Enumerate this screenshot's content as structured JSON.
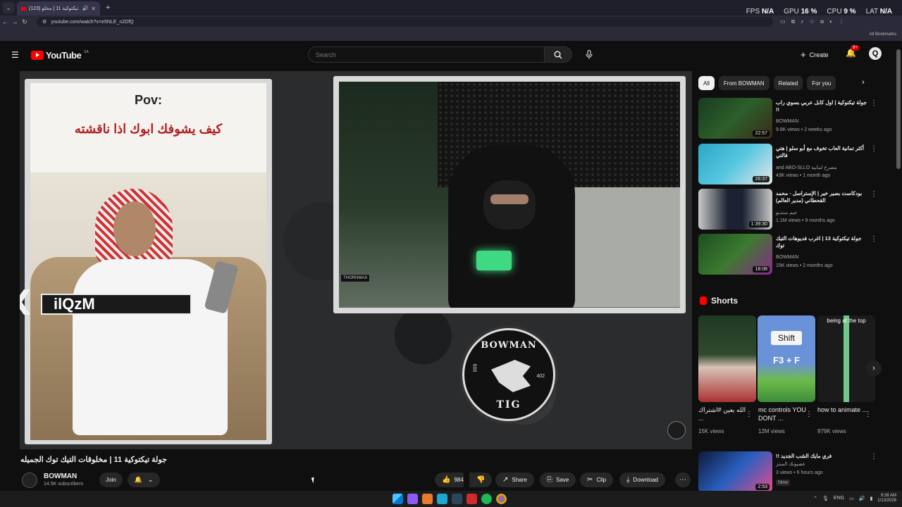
{
  "browser": {
    "tab_title": "(123) جولة تيكتوكية 11 | مخلو...",
    "url": "youtube.com/watch?v=e5NLE_n2DfQ",
    "bookmarks_label": "All Bookmarks",
    "hud": {
      "fps_label": "FPS",
      "fps_value": "N/A",
      "gpu_label": "GPU",
      "gpu_value": "16 %",
      "cpu_label": "CPU",
      "cpu_value": "9 %",
      "lat_label": "LAT",
      "lat_value": "N/A"
    }
  },
  "header": {
    "logo_text": "YouTube",
    "region": "SA",
    "search_placeholder": "Search",
    "create_label": "Create",
    "notifications_badge": "9+",
    "avatar_letter": "Q"
  },
  "player": {
    "pov_text": "Pov:",
    "caption_arabic": "كيف يشوفك ابوك اذا ناقشته",
    "overlay_name": "ilQzM",
    "cam_tag": "THORNMAX",
    "logo_top": "BOWMAN",
    "logo_bottom": "TIG",
    "logo_num_left": "009",
    "logo_num_right": "402"
  },
  "video": {
    "title": "جولة تيكتوكية 11 | مخلوقات التيك توك الجميله",
    "channel": "BOWMAN",
    "subscribers": "14.5K subscribers",
    "join_label": "Join",
    "likes": "984",
    "share_label": "Share",
    "save_label": "Save",
    "clip_label": "Clip",
    "download_label": "Download"
  },
  "chips": [
    "All",
    "From BOWMAN",
    "Related",
    "For you"
  ],
  "recommendations": [
    {
      "title": "جولة تيكتوكية | اول كابل عربي بسوي راب !!",
      "channel": "BOWMAN",
      "meta": "9.8K views • 2 weeks ago",
      "duration": "22:57"
    },
    {
      "title": "أكثر تمانية العاب تخوف مع أبو سلو | هتي فالتي",
      "channel": "and ABO-SLLO مصرخ لمانية",
      "meta": "43K views • 1 month ago",
      "duration": "26:37"
    },
    {
      "title": "بودكاست بصير خير | الإستراسل - محمد القحطاني (مدير العالم)",
      "channel": "جيم ستديو",
      "meta": "1.1M views • 9 months ago",
      "duration": "1:39:30"
    },
    {
      "title": "جولة تيكتوكية 13 | اغرب فديوهات التيك توك",
      "channel": "BOWMAN",
      "meta": "15K views • 2 months ago",
      "duration": "18:08"
    }
  ],
  "shorts": {
    "heading": "Shorts",
    "items": [
      {
        "caption": "الله يعين #اشتراك ...",
        "views": "15K views"
      },
      {
        "caption": "mc controls YOU DONT ...",
        "views": "12M views",
        "thumb_title": "Shift",
        "thumb_keys": "F3 + F"
      },
      {
        "caption": "how to animate ...",
        "views": "979K views",
        "thumb_title": "being at the top"
      }
    ]
  },
  "last_rec": {
    "title": "فري مايك الشب الجديد !!",
    "channel": "عصبونك المبتز",
    "meta": "3 views • 6 hours ago",
    "badge": "New",
    "duration": "2:53"
  },
  "taskbar": {
    "lang": "ENG",
    "time": "9:38 AM",
    "date": "1/13/2026"
  }
}
